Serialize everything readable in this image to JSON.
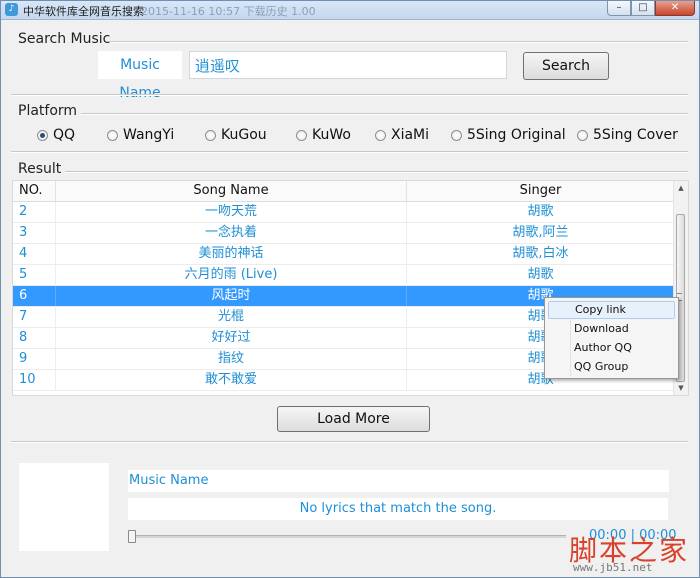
{
  "window": {
    "title": "中华软件库全网音乐搜索",
    "title_ghost": "2015-11-16  10:57    下载历史        1.00",
    "app_icon": "music-note-icon",
    "controls": {
      "minimize": "–",
      "maximize": "□",
      "close": "✕"
    }
  },
  "search": {
    "section_label": "Search Music",
    "music_name_label": "Music Name",
    "query_value": "逍遥叹",
    "button_label": "Search"
  },
  "platform": {
    "section_label": "Platform",
    "options": [
      "QQ",
      "WangYi",
      "KuGou",
      "KuWo",
      "XiaMi",
      "5Sing Original",
      "5Sing Cover"
    ],
    "selected": "QQ"
  },
  "result": {
    "section_label": "Result",
    "columns": [
      "NO.",
      "Song Name",
      "Singer"
    ],
    "rows": [
      {
        "no": "2",
        "song": "一吻天荒",
        "singer": "胡歌"
      },
      {
        "no": "3",
        "song": "一念执着",
        "singer": "胡歌,阿兰"
      },
      {
        "no": "4",
        "song": "美丽的神话",
        "singer": "胡歌,白冰"
      },
      {
        "no": "5",
        "song": "六月的雨 (Live)",
        "singer": "胡歌"
      },
      {
        "no": "6",
        "song": "风起时",
        "singer": "胡歌"
      },
      {
        "no": "7",
        "song": "光棍",
        "singer": "胡歌"
      },
      {
        "no": "8",
        "song": "好好过",
        "singer": "胡歌"
      },
      {
        "no": "9",
        "song": "指纹",
        "singer": "胡歌"
      },
      {
        "no": "10",
        "song": "敢不敢爱",
        "singer": "胡歌"
      }
    ],
    "selected_no": "6",
    "load_more_label": "Load More"
  },
  "context_menu": {
    "items": [
      "Copy link",
      "Download",
      "Author QQ",
      "QQ Group"
    ],
    "highlighted": "Copy link"
  },
  "player": {
    "music_name_label": "Music Name",
    "lyrics_text": "No lyrics that match the song.",
    "time_text": "00:00 | 00:00",
    "progress": 0
  },
  "watermark": {
    "brand": "脚本之家",
    "url": "www.jb51.net"
  },
  "colors": {
    "accent": "#1e8fd5",
    "selection": "#3399ff",
    "watermark": "#d9422a"
  }
}
